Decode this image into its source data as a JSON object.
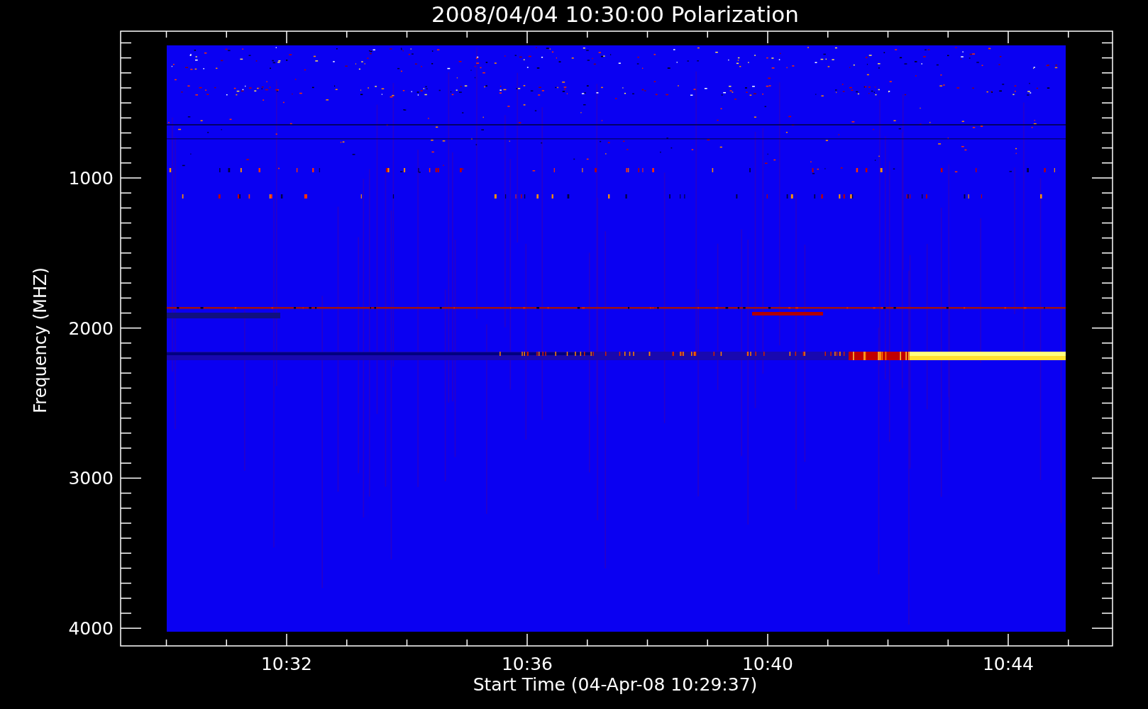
{
  "title": "2008/04/04 10:30:00 Polarization",
  "y_axis": {
    "label": "Frequency (MHZ)",
    "ticks": [
      "1000",
      "2000",
      "3000",
      "4000"
    ]
  },
  "x_axis": {
    "label": "Start Time (04-Apr-08 10:29:37)",
    "ticks": [
      "10:32",
      "10:36",
      "10:40",
      "10:44"
    ]
  }
}
